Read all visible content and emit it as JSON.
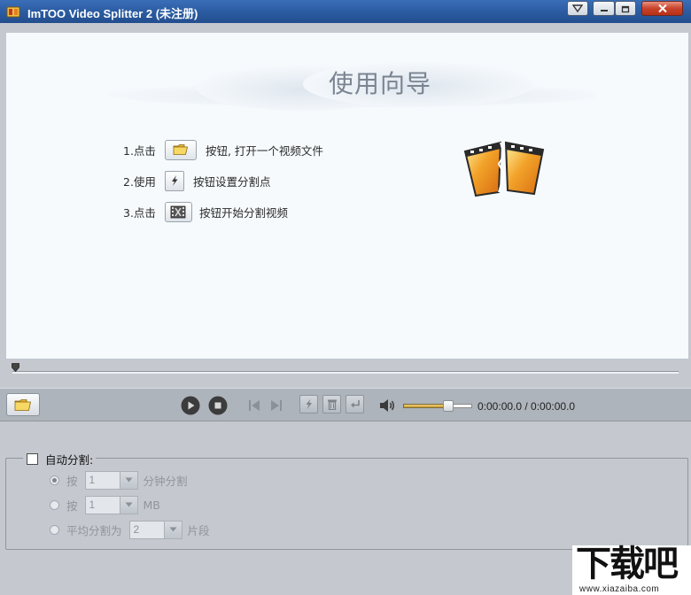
{
  "window": {
    "title": "ImTOO Video Splitter 2 (未注册)",
    "controls": [
      "menu-down-icon",
      "minimize-icon",
      "restore-icon",
      "close-icon"
    ]
  },
  "wizard": {
    "title": "使用向导",
    "steps": [
      {
        "prefix": "1.点击",
        "icon": "open-folder-icon",
        "suffix": "按钮, 打开一个视频文件"
      },
      {
        "prefix": "2.使用",
        "icon": "split-point-icon",
        "suffix": "按钮设置分割点"
      },
      {
        "prefix": "3.点击",
        "icon": "start-split-icon",
        "suffix": "按钮开始分割视频"
      }
    ]
  },
  "player": {
    "time": "0:00:00.0 / 0:00:00.0",
    "volume_level": 0.7,
    "seek_position": 0
  },
  "auto_split": {
    "label": "自动分割:",
    "checked": false,
    "options": [
      {
        "prefix": "按",
        "value": "1",
        "suffix": "分钟分割",
        "selected": true
      },
      {
        "prefix": "按",
        "value": "1",
        "suffix": "MB",
        "selected": false
      },
      {
        "prefix": "平均分割为",
        "value": "2",
        "suffix": "片段",
        "selected": false
      }
    ]
  },
  "watermark": {
    "big": "下载吧",
    "small": "www.xiazaiba.com"
  },
  "colors": {
    "titlebar": "#2a5aa0",
    "panel": "#c5c9cf",
    "wizard_bg": "#f6fafd",
    "close_button": "#c8432b",
    "volume_fill": "#d9b24a"
  }
}
